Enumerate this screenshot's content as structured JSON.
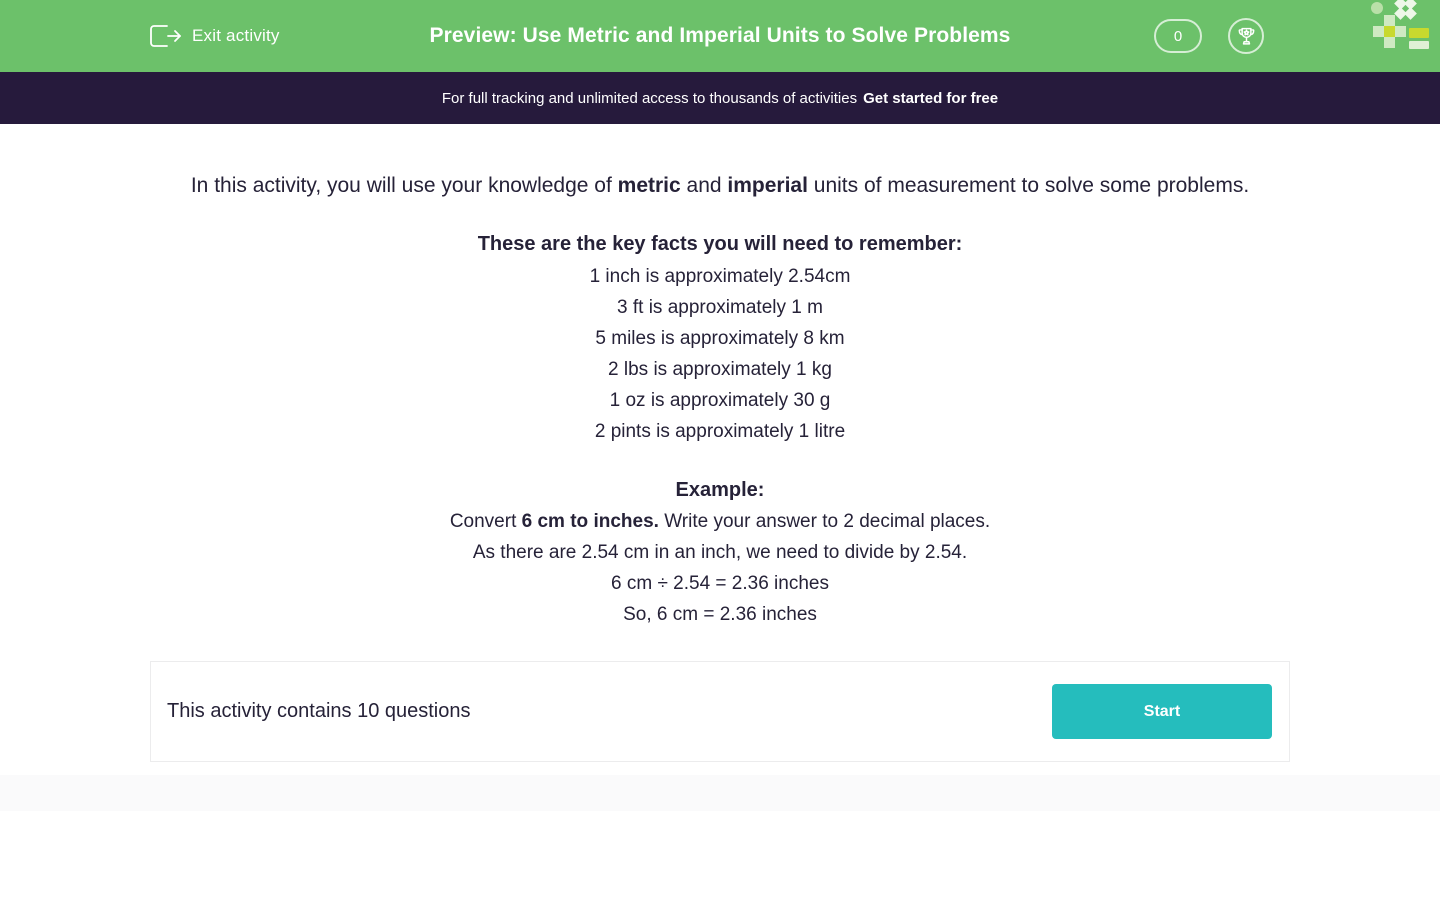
{
  "header": {
    "exit_label": "Exit activity",
    "exit_icon": "exit-arrow-icon",
    "title": "Preview: Use Metric and Imperial Units to Solve Problems",
    "score_value": "0",
    "trophy_icon": "trophy-icon",
    "logo_icon": "brand-logo-mark",
    "background_color": "#6cc16a"
  },
  "promo": {
    "text": "For full tracking and unlimited access to thousands of activities",
    "link_label": "Get started for free",
    "background_color": "#261a3c"
  },
  "intro": {
    "part1": "In this activity, you will use your knowledge of ",
    "bold1": "metric",
    "part2": " and ",
    "bold2": "imperial",
    "part3": " units of measurement to solve some problems."
  },
  "facts": {
    "heading": "These are the key facts you will need to remember:",
    "lines": [
      "1 inch is approximately 2.54cm",
      "3 ft is approximately 1 m",
      "5 miles is approximately 8 km",
      "2 lbs is approximately 1 kg",
      "1 oz is approximately 30 g",
      "2 pints is approximately 1 litre"
    ]
  },
  "example": {
    "heading": "Example:",
    "line1_part1": "Convert ",
    "line1_bold": "6 cm to inches.",
    "line1_part2": " Write your answer to 2 decimal places.",
    "line2": "As there are 2.54 cm in an inch, we need to divide by 2.54.",
    "line3": "6 cm ÷ 2.54 = 2.36 inches",
    "line4": "So, 6 cm = 2.36 inches"
  },
  "activity_card": {
    "question_count_text": "This activity contains 10 questions",
    "start_label": "Start",
    "start_color": "#25bdbd"
  }
}
